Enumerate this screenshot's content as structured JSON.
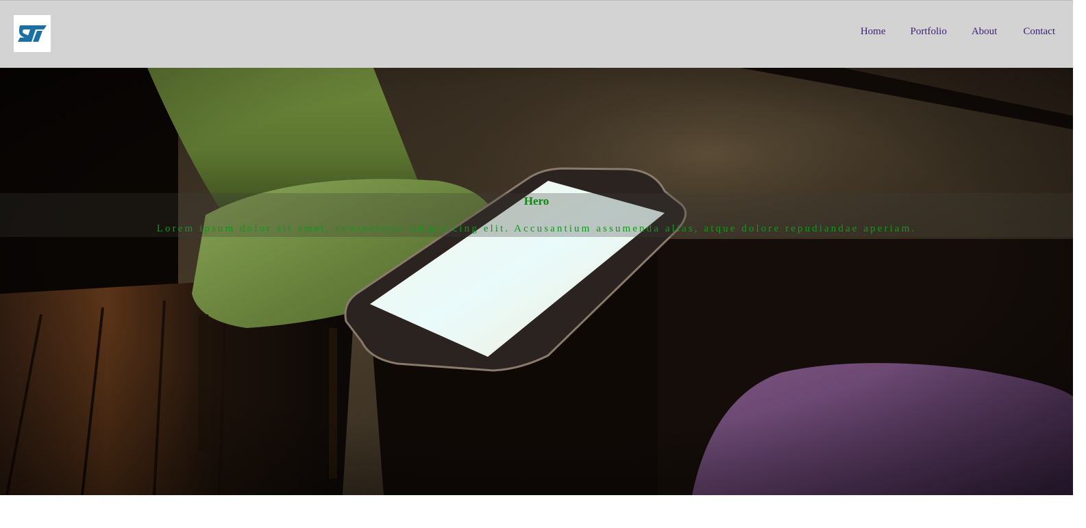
{
  "header": {
    "logo": {
      "icon": "st-logo-icon",
      "text": "ST"
    },
    "nav": {
      "home": "Home",
      "portfolio": "Portfolio",
      "about": "About",
      "contact": "Contact"
    }
  },
  "hero": {
    "title": "Hero",
    "text": "Lorem ipsum dolor sit amet, consectetur adipisicing elit. Accusantium assumenda alias, atque dolore repudiandae aperiam.",
    "background_image": "dark room with green armchair, tablet on side table, purple cushion"
  },
  "colors": {
    "header_bg": "#d3d3d3",
    "nav_link": "#3f1f73",
    "hero_text": "#0e9a18",
    "logo_blue": "#1a6fa3"
  }
}
